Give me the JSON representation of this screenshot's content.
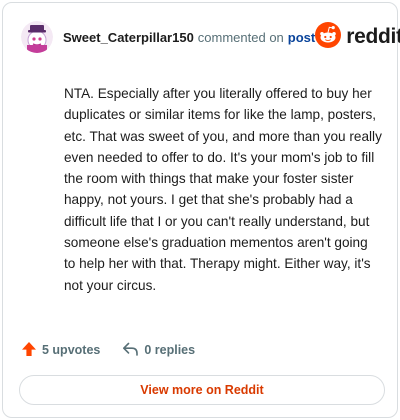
{
  "header": {
    "username": "Sweet_Caterpillar150",
    "commented_text": "commented on",
    "post_link": "post",
    "brand_text": "reddit",
    "avatar_icon": "snoo-avatar-icon",
    "brand_icon": "reddit-snoo-icon"
  },
  "comment": {
    "text": "NTA. Especially after you literally offered to buy her duplicates or similar items for like the lamp, posters, etc. That was sweet of you, and more than you really even needed to offer to do. It's your mom's job to fill the room with things that make your foster sister happy, not yours. I get that she's probably had a difficult life that I or you can't really understand, but someone else's graduation mementos aren't going to help her with that. Therapy might. Either way, it's not your circus."
  },
  "actions": {
    "upvotes_label": "5 upvotes",
    "replies_label": "0 replies",
    "upvote_icon": "upvote-arrow-icon",
    "reply_icon": "reply-icon"
  },
  "footer": {
    "view_more_label": "View more on Reddit"
  },
  "colors": {
    "brand_orange": "#ff4500",
    "link_blue": "#0a449b",
    "cta_orange": "#d93a00",
    "muted": "#576f76",
    "border": "#d9dde0"
  }
}
